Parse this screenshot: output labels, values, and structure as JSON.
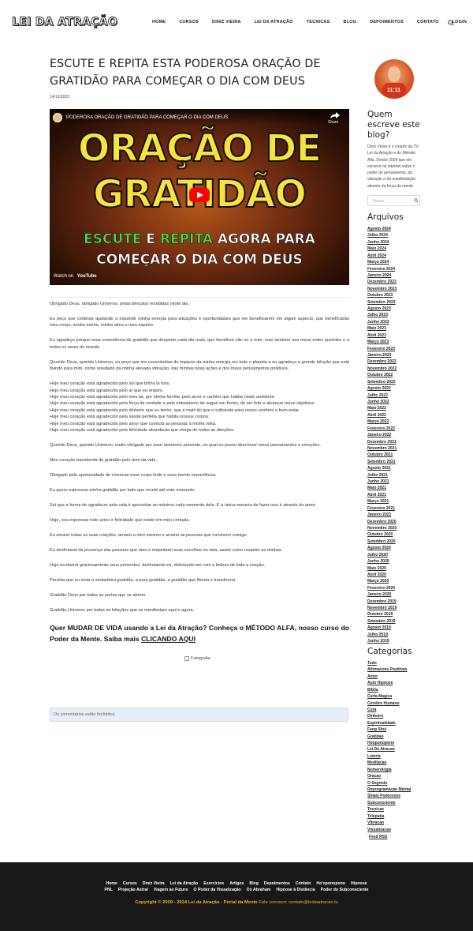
{
  "header": {
    "logo": "LEI DA ATRAÇÃO",
    "nav": [
      "Home",
      "CURSOS",
      "DINIZ VIEIRA",
      "LEI DA ATRAÇÃO",
      "TECNICAS",
      "BLOG",
      "DEPOIMENTOS",
      "CONTATO",
      "LOGIN"
    ]
  },
  "article": {
    "title": "ESCUTE E REPITA ESTA PODEROSA ORAÇÃO DE GRATIDÃO PARA COMEÇAR O DIA COM DEUS",
    "date": "14/12/2023",
    "video": {
      "caption": "PODEROSA ORAÇÃO DE GRATIDÃO PARA COMEÇAR O DIA COM DEUS",
      "share": "Share",
      "thumb_line1": "ORAÇÃO DE",
      "thumb_line2": "GRATIDÃO",
      "thumb_sub1_a": "ESCUTE",
      "thumb_sub1_b": "E",
      "thumb_sub1_c": "REPITA",
      "thumb_sub1_d": "AGORA PARA",
      "thumb_sub2": "COMEÇAR O DIA COM DEUS",
      "watch_on": "Watch on",
      "platform": "YouTube"
    },
    "paragraphs_a": [
      "Obrigado Deus, obrigado Universo, pelas bênçãos recebidas neste dia.",
      "Eu peço que continue ajudando a expandir minha energia para situações e oportunidades que me beneficiarem em algum aspecto, que beneficiarão meu corpo, minha mente, minha alma e meu espírito.",
      "Eu agradeço porque essa consciência de gratidão que desperto cada dia mais, que beneficia não só a mim, mas também aos meus entes queridos e a todos os seres do mundo.",
      "Querido Deus, querido Universo, eu peço que me conscientize do impacto da minha energia em todo o planeta e eu agradeço a grande bênção que está fluindo para mim, como resultado da minha elevada vibração, das minhas boas ações e dos meus pensamentos positivos."
    ],
    "lines": [
      "Hoje meu coração está agradecido pelo sol que brilha lá fora.",
      "Hoje meu coração está agradecido pelo ar que eu respiro.",
      "Hoje meu coração está agradecido pelo meu lar, por minha família, pelo amor e carinho que habita neste ambiente.",
      "Hoje meu coração está agradecido pela força de vontade e pelo entusiasmo de seguir em frente, de ser feliz e alcançar meus objetivos.",
      "Hoje meu coração está agradecido pelo dinheiro que eu tenho, que é mais do que o suficiente para nosso conforto e bem-estar.",
      "Hoje meu coração está agradecido pela saúde perfeita que habita nossos corpos.",
      "Hoje meu coração está agradecido pelo amor que conecta as pessoas à minha volta.",
      "Hoje meu coração está agradecido pela felicidade abundante que chega de todas as direções."
    ],
    "paragraphs_b": [
      "Querido Deus, querido Universo, muito obrigado por esse momento presente, no qual eu posso direcionar meus pensamentos e emoções.",
      "Meu coração transborda de gratidão pelo dom da vida.",
      "Obrigado pela oportunidade de vivenciar esse corpo lindo e essa mente maravilhosa.",
      "Eu quero expressar minha gratidão por tudo que recebi até este momento.",
      "Sei que a forma de agradecer pela vida é aproveitar ao máximo cada momento dela. E a única maneira de fazer isso é através do amor.",
      "Hoje, vou expressar todo amor e felicidade que existe em meu coração.",
      "Eu amarei todas as suas criações, amarei a mim mesmo e amarei as pessoas que convivem comigo.",
      "Eu desfrutarei da presença das pessoas que amo e respeitarei suas escolhas na vida, assim como respeito as minhas.",
      "Hoje receberei graciosamente seus presentes, desfrutando-os, deliciando-me com a beleza de toda a criação.",
      "Permita que eu sinta a verdadeira gratidão, a pura gratidão, a gratidão que liberta e transforma.",
      "Gratidão Deus por todas as portas que se abrem.",
      "Gratidão Universo por todas as bênçãos que se manifestam aqui e agora."
    ],
    "cta_text": "Quer MUDAR DE VIDA usando a Lei da Atração? Conheça o MÉTODO ALFA, nosso curso do Poder da Mente. Saiba mais ",
    "cta_link": "CLICANDO AQUI",
    "image_alt": "Fotografia",
    "comments_closed": "Os comentários estão fechados."
  },
  "sidebar": {
    "about_title": "Quem escreve este blog?",
    "about_text": "Diniz Vieira é o criador da TV Lei da Atração e do Método Alfa. Desde 2009 que ele escreve na internet sobre o poder do pensamento, da vibração e da manifestação através da força da mente.",
    "avatar_badge": "11:11",
    "search_placeholder": "Busca",
    "archives_title": "Arquivos",
    "archives": [
      "Agosto 2024",
      "Julho 2024",
      "Junho 2024",
      "Maio 2024",
      "Abril 2024",
      "Março 2024",
      "Fevereiro 2024",
      "Janeiro 2024",
      "Dezembro 2023",
      "Novembro 2023",
      "Outubro 2023",
      "Setembro 2023",
      "Agosto 2023",
      "Julho 2023",
      "Junho 2023",
      "Maio 2023",
      "Abril 2023",
      "Março 2023",
      "Fevereiro 2023",
      "Janeiro 2023",
      "Dezembro 2022",
      "Novembro 2022",
      "Outubro 2022",
      "Setembro 2022",
      "Agosto 2022",
      "Julho 2022",
      "Junho 2022",
      "Maio 2022",
      "Abril 2022",
      "Março 2022",
      "Fevereiro 2022",
      "Janeiro 2022",
      "Dezembro 2021",
      "Novembro 2021",
      "Outubro 2021",
      "Setembro 2021",
      "Agosto 2021",
      "Julho 2021",
      "Junho 2021",
      "Maio 2021",
      "Abril 2021",
      "Março 2021",
      "Fevereiro 2021",
      "Janeiro 2021",
      "Dezembro 2020",
      "Novembro 2020",
      "Outubro 2020",
      "Setembro 2020",
      "Agosto 2020",
      "Julho 2020",
      "Junho 2020",
      "Maio 2020",
      "Abril 2020",
      "Março 2020",
      "Fevereiro 2020",
      "Janeiro 2020",
      "Dezembro 2019",
      "Novembro 2019",
      "Outubro 2019",
      "Setembro 2019",
      "Agosto 2019",
      "Julho 2019",
      "Junho 2019"
    ],
    "categories_title": "Categorias",
    "categories": [
      "Tudo",
      "Afirmacoes Positivas",
      "Amor",
      "Auto Hipnose",
      "Bíblia",
      "Carta Magica",
      "Cerebro Humano",
      "Cura",
      "Dinheiro",
      "Espiritualidade",
      "Feng Shui",
      "Gratidao",
      "Hooponopono",
      "Lei Da Atracao",
      "Loteria",
      "Meditacao",
      "Numerologia",
      "Oracao",
      "O Segredo",
      "Reprogramacao Mental",
      "Sinais Poderosos",
      "Subconsciente",
      "Tecnicas",
      "Telepatia",
      "Vibracao",
      "Visualizacao"
    ],
    "feed": "Feed RSS"
  },
  "footer": {
    "nav1": [
      "Home",
      "Cursos",
      "Diniz Vieira",
      "Lei da Atração",
      "Exercícios",
      "Artigos",
      "Blog",
      "Depoimentos",
      "Contato",
      "Ho'oponopono",
      "Hipnose"
    ],
    "nav2": [
      "PNL",
      "Projeção Astral",
      "Viagem ao Futuro",
      "O Poder da Visualização",
      "Os Abraham",
      "Hipnose à Distância",
      "Poder do Subconsciente"
    ],
    "copyright": "Copyright © 2009 - 2024 Lei da Atração - Portal da Mente",
    "contact": "Fale conosco: contato@leidaatracao.tv"
  },
  "colors": {
    "footer_bg": "#18181b",
    "accent_gold": "#f2b31a",
    "youtube_red": "#ff0000",
    "thumb_yellow": "#f6e43a"
  }
}
